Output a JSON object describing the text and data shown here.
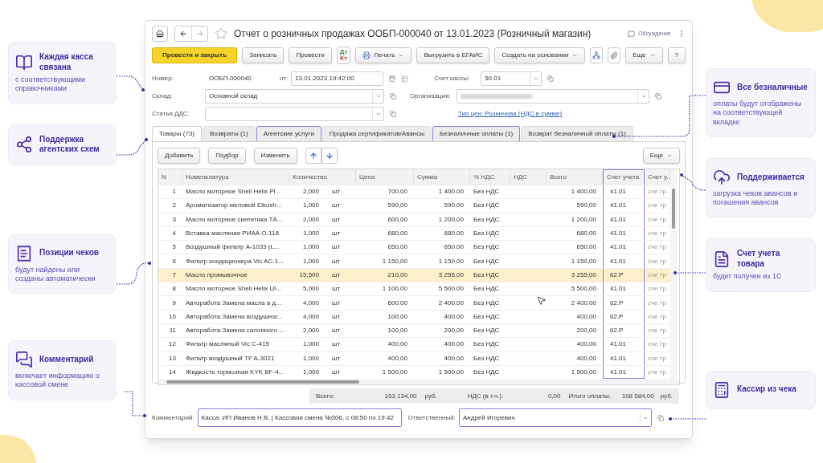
{
  "callouts_left": [
    {
      "title": "Каждая касса связана",
      "text": "с соответствующими справочниками"
    },
    {
      "title": "Поддержка агентских схем"
    },
    {
      "title": "Позиции чеков",
      "text": "будут найдены или созданы автоматически"
    },
    {
      "title": "Комментарий",
      "text": "включает информацию о кассовой смене"
    }
  ],
  "callouts_right": [
    {
      "title": "Все безналичные",
      "text": "оплаты будут отображены на соответствующей вкладке"
    },
    {
      "title": "Поддерживается",
      "text": "загрузка чеков авансов и погашения авансов"
    },
    {
      "title": "Счет учета товара",
      "text": "будет получен из 1С"
    },
    {
      "title": "Кассир из чека"
    }
  ],
  "window": {
    "title": "Отчет о розничных продажах ООБП-000040 от 13.01.2023 (Розничный магазин)",
    "discussion": "Обсуждение",
    "toolbar": [
      {
        "kind": "primary",
        "label": "Провести и закрыть"
      },
      {
        "kind": "button",
        "label": "Записать"
      },
      {
        "kind": "button",
        "label": "Провести"
      },
      {
        "kind": "dtkt",
        "top": "Дт",
        "bottom": "Кт"
      },
      {
        "kind": "print",
        "label": "Печать"
      },
      {
        "kind": "button",
        "label": "Выгрузить в ЕГАИС"
      },
      {
        "kind": "dropdown",
        "label": "Создать на основании"
      },
      {
        "kind": "structure"
      },
      {
        "kind": "attach"
      },
      {
        "kind": "dropdown",
        "label": "Еще"
      },
      {
        "kind": "button",
        "label": "?"
      }
    ],
    "header": {
      "number_label": "Номер:",
      "number": "ООБП-000040",
      "date_label": "от:",
      "date": "13.01.2023 19:42:00",
      "cash_account_label": "Счет кассы:",
      "cash_account": "50.01",
      "warehouse_label": "Склад:",
      "warehouse": "Основной склад",
      "organization_label": "Организация:",
      "dds_label": "Статья ДДС:",
      "price_type_link": "Тип цен: Розничная (НДС в сумме)"
    },
    "tabs": [
      {
        "label": "Товары (73)",
        "selected": true,
        "highlighted": false
      },
      {
        "label": "Возвраты (1)",
        "selected": false,
        "highlighted": false
      },
      {
        "label": "Агентские услуги",
        "selected": false,
        "highlighted": true
      },
      {
        "label": "Продажа сертификатов/Авансы",
        "selected": false,
        "highlighted": false
      },
      {
        "label": "Безналичные оплаты (1)",
        "selected": false,
        "highlighted": true
      },
      {
        "label": "Возврат безналичной оплаты (1)",
        "selected": false,
        "highlighted": false
      }
    ],
    "table_toolbar": {
      "buttons": [
        "Добавить",
        "Подбор",
        "Изменить"
      ],
      "more": "Еще"
    },
    "table": {
      "columns": [
        {
          "label": "N",
          "highlighted": false
        },
        {
          "label": "Номенклатура",
          "highlighted": false
        },
        {
          "label": "Количество",
          "highlighted": false
        },
        {
          "highlighted": false
        },
        {
          "label": "Цена",
          "highlighted": false
        },
        {
          "label": "Сумма",
          "highlighted": false
        },
        {
          "label": "% НДС",
          "highlighted": false
        },
        {
          "label": "НДС",
          "highlighted": false
        },
        {
          "label": "Всего",
          "highlighted": false
        },
        {
          "label": "Счет учета",
          "highlighted": true
        },
        {
          "label": "Счет у..",
          "highlighted": false
        }
      ],
      "rows": [
        {
          "selected": false,
          "cells": [
            "1",
            "Масло моторное Shell Helix Pl...",
            "2,000",
            "шт",
            "700,00",
            "1 400,00",
            "Без НДС",
            "",
            "1 400,00",
            "41.01",
            "сче тр"
          ]
        },
        {
          "selected": false,
          "cells": [
            "2",
            "Ароматизатор меловой Eikosh...",
            "1,000",
            "шт",
            "590,00",
            "590,00",
            "Без НДС",
            "",
            "590,00",
            "41.01",
            "сче тр"
          ]
        },
        {
          "selected": false,
          "cells": [
            "3",
            "Масло моторное синтетика ТА...",
            "2,000",
            "шт",
            "600,00",
            "1 200,00",
            "Без НДС",
            "",
            "1 200,00",
            "41.01",
            "сче тр"
          ]
        },
        {
          "selected": false,
          "cells": [
            "4",
            "Вставка масляная РИАА О-118",
            "1,000",
            "шт",
            "680,00",
            "680,00",
            "Без НДС",
            "",
            "680,00",
            "41.01",
            "сче тр"
          ]
        },
        {
          "selected": false,
          "cells": [
            "5",
            "Воздушный фильтр А-1033 (L...",
            "1,000",
            "шт",
            "650,00",
            "650,00",
            "Без НДС",
            "",
            "650,00",
            "41.01",
            "сче тр"
          ]
        },
        {
          "selected": false,
          "cells": [
            "6",
            "Фильтр кондиционера Vic AC-1...",
            "1,000",
            "шт",
            "1 150,00",
            "1 150,00",
            "Без НДС",
            "",
            "1 150,00",
            "41.01",
            "сче тр"
          ]
        },
        {
          "selected": true,
          "cells": [
            "7",
            "Масло промывочное",
            "15,500",
            "шт",
            "210,00",
            "3 255,00",
            "Без НДС",
            "",
            "3 255,00",
            "62.Р",
            "сче тр"
          ]
        },
        {
          "selected": false,
          "cells": [
            "8",
            "Масло моторное Shell Helix Ul...",
            "5,000",
            "шт",
            "1 100,00",
            "5 500,00",
            "Без НДС",
            "",
            "5 500,00",
            "41.01",
            "сче тр"
          ]
        },
        {
          "selected": false,
          "cells": [
            "9",
            "Авторабота Замена масла в д...",
            "4,000",
            "шт",
            "600,00",
            "2 400,00",
            "Без НДС",
            "",
            "2 400,00",
            "62.Р",
            "сче тр"
          ]
        },
        {
          "selected": false,
          "cells": [
            "10",
            "Авторабота Замена воздушног...",
            "4,000",
            "шт",
            "100,00",
            "400,00",
            "Без НДС",
            "",
            "400,00",
            "62.Р",
            "сче тр"
          ]
        },
        {
          "selected": false,
          "cells": [
            "11",
            "Авторабота Замена салонного ...",
            "2,000",
            "шт",
            "100,00",
            "200,00",
            "Без НДС",
            "",
            "200,00",
            "62.Р",
            "сче тр"
          ]
        },
        {
          "selected": false,
          "cells": [
            "12",
            "Фильтр масляный Vic C-415",
            "1,000",
            "шт",
            "400,00",
            "400,00",
            "Без НДС",
            "",
            "400,00",
            "41.01",
            "сче тр"
          ]
        },
        {
          "selected": false,
          "cells": [
            "13",
            "Фильтр воздушный TF A-3021",
            "1,000",
            "шт",
            "400,00",
            "400,00",
            "Без НДС",
            "",
            "400,00",
            "41.01",
            "сче тр"
          ]
        },
        {
          "selected": false,
          "cells": [
            "14",
            "Жидкость тормозная KYK BF-4...",
            "1,000",
            "шт",
            "1 500,00",
            "1 500,00",
            "Без НДС",
            "",
            "1 500,00",
            "41.01",
            "сче тр"
          ]
        }
      ]
    },
    "totals": {
      "total_label": "Всего:",
      "total": "153 134,00",
      "currency": "руб.",
      "vat_label": "НДС (в т.ч.):",
      "vat": "0,00",
      "paid_label": "Итого оплаты:",
      "paid": "108 584,00",
      "paid_currency": "руб."
    },
    "footer": {
      "comment_label": "Комментарий:",
      "comment": "Касса: ИП Иванов Н.В. | Кассовая смена №306, с 08:50 по 19:42",
      "comment_highlighted": true,
      "responsible_label": "Ответственный:",
      "responsible": "Андрей Игоревич",
      "responsible_highlighted": true
    }
  }
}
